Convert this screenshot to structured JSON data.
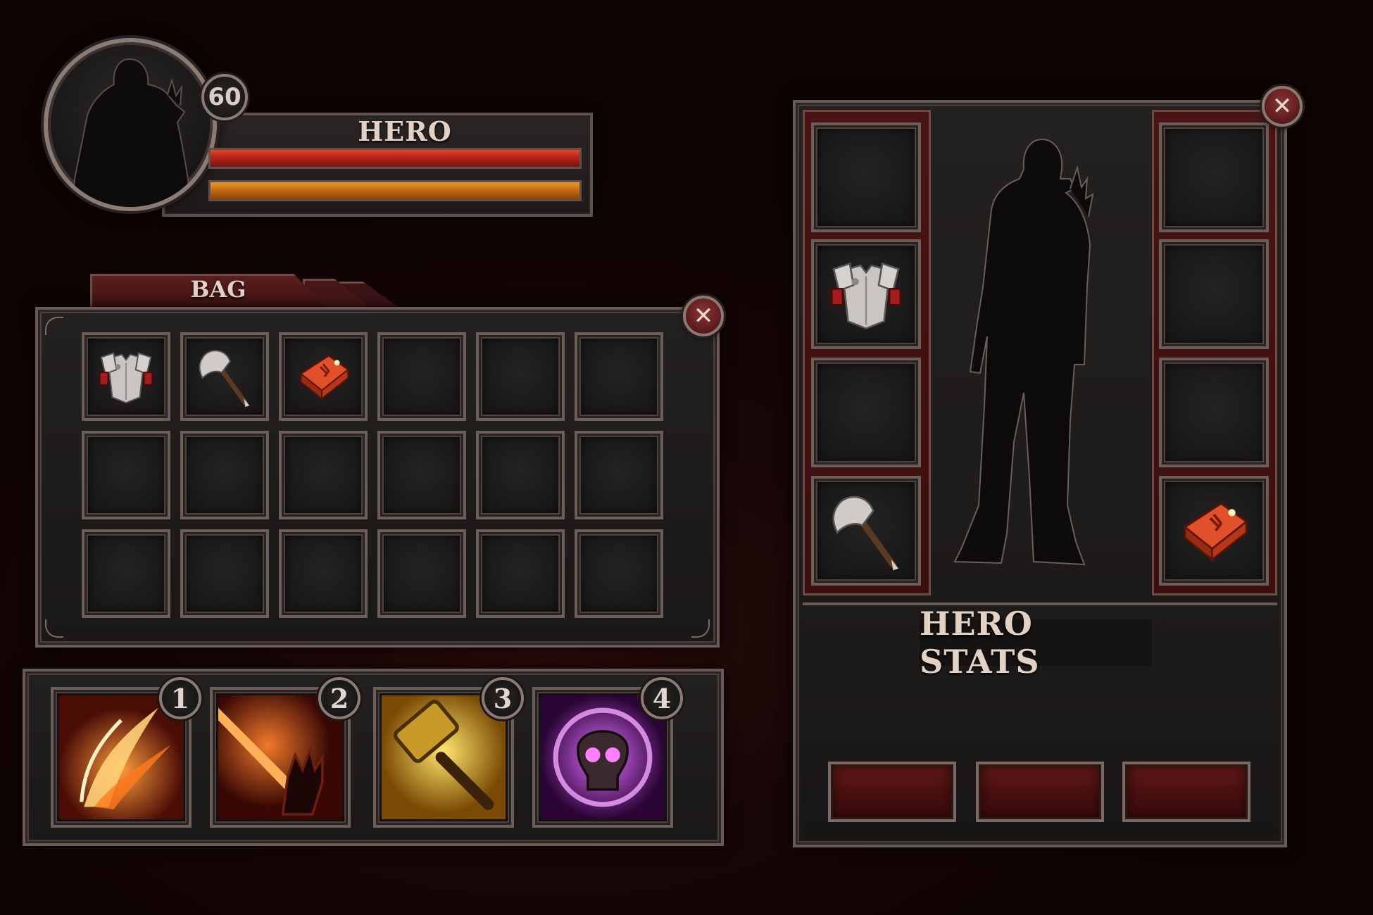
{
  "hero": {
    "level": "60",
    "name": "HERO",
    "hp_fraction": 1.0,
    "mana_fraction": 1.0
  },
  "bag": {
    "tab_label": "BAG",
    "close_icon": "close-icon",
    "rows": 3,
    "cols": 6,
    "items": [
      {
        "slot": 0,
        "icon": "chest-armor-icon"
      },
      {
        "slot": 1,
        "icon": "axe-icon"
      },
      {
        "slot": 2,
        "icon": "red-rune-icon"
      }
    ]
  },
  "skills": [
    {
      "key": "1",
      "icon": "fire-claw-skill-icon"
    },
    {
      "key": "2",
      "icon": "flame-hand-skill-icon"
    },
    {
      "key": "3",
      "icon": "golden-hammer-skill-icon"
    },
    {
      "key": "4",
      "icon": "purple-skull-skill-icon"
    }
  ],
  "equipment": {
    "close_icon": "close-icon",
    "left_slots": [
      "empty",
      "chest-armor-icon",
      "empty",
      "axe-icon"
    ],
    "right_slots": [
      "empty",
      "empty",
      "empty",
      "red-rune-icon"
    ],
    "stats_title": "HERO STATS",
    "buttons": [
      "",
      "",
      ""
    ]
  },
  "colors": {
    "hp": "#c52a1e",
    "mana": "#d47a14",
    "accent_red": "#4a1414",
    "frame": "#6a5a55"
  }
}
